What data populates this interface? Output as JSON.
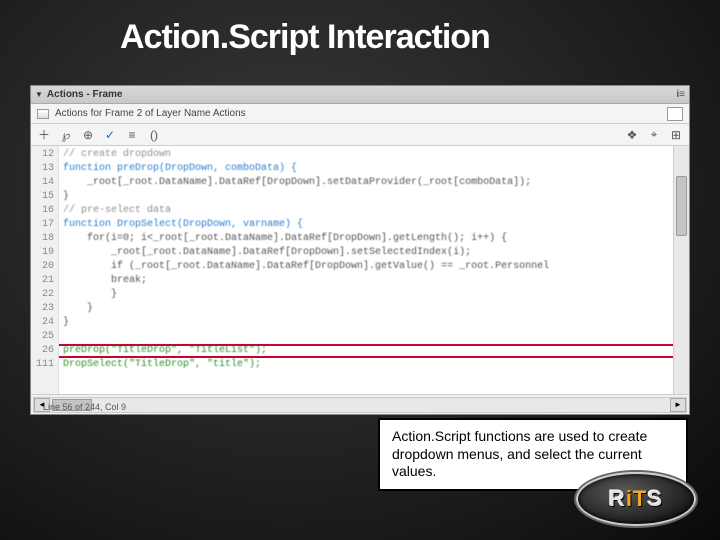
{
  "slide": {
    "title": "Action.Script Interaction"
  },
  "panel": {
    "title": "Actions - Frame",
    "path": "Actions for Frame 2 of Layer Name Actions"
  },
  "toolbar": {
    "icons": [
      {
        "name": "plus-icon",
        "glyph": "＋"
      },
      {
        "name": "wand-icon",
        "glyph": "℘"
      },
      {
        "name": "target-icon",
        "glyph": "⊕"
      },
      {
        "name": "check-icon",
        "glyph": "✓"
      },
      {
        "name": "format-icon",
        "glyph": "≡"
      },
      {
        "name": "paren-icon",
        "glyph": "()"
      }
    ],
    "right_icons": [
      {
        "name": "script-assist-icon",
        "glyph": "❖"
      },
      {
        "name": "reference-icon",
        "glyph": "⌖"
      },
      {
        "name": "help-icon",
        "glyph": "⊞"
      }
    ]
  },
  "code": {
    "gutter": [
      "12",
      "13",
      "14",
      "15",
      "16",
      "17",
      "18",
      "19",
      "20",
      "21",
      "22",
      "23",
      "24",
      "25",
      "26",
      "111"
    ],
    "lines": [
      {
        "text": "// create dropdown",
        "cls": "comment"
      },
      {
        "text": "function preDrop(DropDown, comboData) {",
        "cls": "kw"
      },
      {
        "text": "    _root[_root.DataName].DataRef[DropDown].setDataProvider(_root[comboData]);",
        "cls": ""
      },
      {
        "text": "}",
        "cls": ""
      },
      {
        "text": "// pre-select data",
        "cls": "comment"
      },
      {
        "text": "function DropSelect(DropDown, varname) {",
        "cls": "kw"
      },
      {
        "text": "    for(i=0; i<_root[_root.DataName].DataRef[DropDown].getLength(); i++) {",
        "cls": ""
      },
      {
        "text": "        _root[_root.DataName].DataRef[DropDown].setSelectedIndex(i);",
        "cls": ""
      },
      {
        "text": "        if (_root[_root.DataName].DataRef[DropDown].getValue() == _root.Personnel",
        "cls": ""
      },
      {
        "text": "        break;",
        "cls": ""
      },
      {
        "text": "        }",
        "cls": ""
      },
      {
        "text": "    }",
        "cls": ""
      },
      {
        "text": "}",
        "cls": ""
      },
      {
        "text": "",
        "cls": ""
      },
      {
        "text": "preDrop(\"TitleDrop\", \"TitleList\");",
        "cls": "str"
      },
      {
        "text": "DropSelect(\"TitleDrop\", \"title\");",
        "cls": "str"
      }
    ]
  },
  "status": {
    "text": "Line 56 of 244, Col 9"
  },
  "callout": {
    "text": "Action.Script functions are used to create dropdown menus, and select the current values."
  },
  "logo": {
    "r": "R",
    "it": "iT",
    "s": "S"
  }
}
